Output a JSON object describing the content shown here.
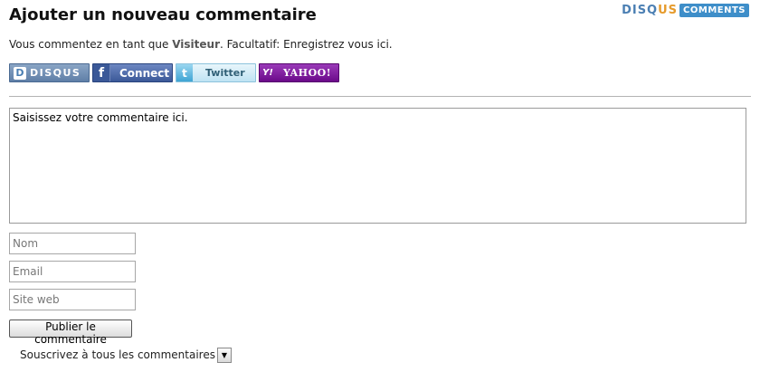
{
  "header": {
    "title": "Ajouter un nouveau commentaire",
    "brand_word_part1": "DISQ",
    "brand_word_part2": "US",
    "brand_badge": "COMMENTS"
  },
  "login_line": {
    "prefix": "Vous commentez en tant que ",
    "visitor": "Visiteur",
    "middle": ". Facultatif: ",
    "register_link": "Enregistrez vous ici",
    "suffix": "."
  },
  "sso_buttons": {
    "disqus": {
      "icon_glyph": "D",
      "label": "DISQUS"
    },
    "facebook": {
      "icon_glyph": "f",
      "label": "Connect"
    },
    "twitter": {
      "icon_glyph": "t",
      "label": "Twitter"
    },
    "yahoo": {
      "icon_glyph": "Y!",
      "label": "YAHOO!"
    }
  },
  "comment": {
    "placeholder": "Saisissez votre commentaire ici."
  },
  "fields": {
    "name_placeholder": "Nom",
    "email_placeholder": "Email",
    "website_placeholder": "Site web"
  },
  "submit_label": "Publier le commentaire",
  "subscribe": {
    "label": "Souscrivez à tous les commentaires",
    "arrow_glyph": "▼"
  },
  "colors": {
    "disqus_blue": "#4b7fb3",
    "disqus_orange": "#e69b2c",
    "facebook": "#3b5998",
    "twitter": "#8cc3dc",
    "yahoo": "#6b0a8a"
  }
}
